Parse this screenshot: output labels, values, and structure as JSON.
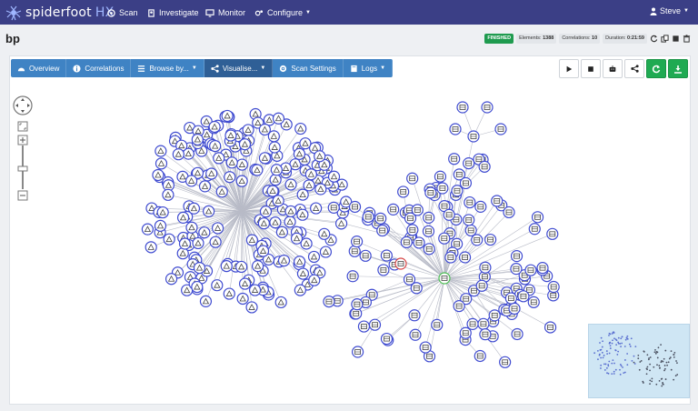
{
  "app": {
    "logo_text": "spiderfoot",
    "logo_suffix": "HX"
  },
  "nav": {
    "items": [
      {
        "label": "Scan",
        "icon": "scan-icon"
      },
      {
        "label": "Investigate",
        "icon": "investigate-icon"
      },
      {
        "label": "Monitor",
        "icon": "monitor-icon"
      },
      {
        "label": "Configure",
        "icon": "configure-icon"
      }
    ],
    "user": "Steve"
  },
  "page": {
    "title": "bp",
    "status": "FINISHED",
    "elements_label": "Elements:",
    "elements_value": "1388",
    "correlations_label": "Correlations:",
    "correlations_value": "10",
    "duration_label": "Duration:",
    "duration_value": "0:21:59"
  },
  "tabs": [
    {
      "label": "Overview",
      "icon": "overview-icon"
    },
    {
      "label": "Correlations",
      "icon": "info-icon"
    },
    {
      "label": "Browse by...",
      "icon": "list-icon"
    },
    {
      "label": "Visualise...",
      "icon": "share-icon"
    },
    {
      "label": "Scan Settings",
      "icon": "gear-icon"
    },
    {
      "label": "Logs",
      "icon": "book-icon"
    }
  ],
  "actions": [
    "play-icon",
    "stop-icon",
    "robot-icon",
    "share-icon",
    "refresh-icon",
    "download-icon"
  ],
  "colors": {
    "topbar": "#3b3f86",
    "tabs": "#3f83c4",
    "active_tab": "#2f5f96",
    "green": "#1faa52",
    "node_stroke": "#3f4bd0",
    "node_fill": "#ffffff",
    "highlight_red": "#d64545",
    "highlight_green": "#4bbd52"
  }
}
